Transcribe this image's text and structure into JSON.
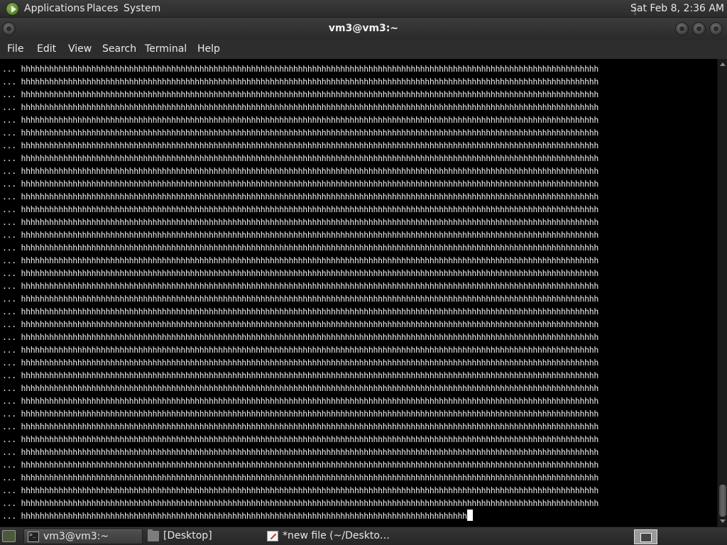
{
  "top_panel": {
    "menus": [
      "Applications",
      "Places",
      "System"
    ],
    "clock": "Sat Feb  8,  2:36 AM"
  },
  "window": {
    "title": "vm3@vm3:~"
  },
  "menubar": {
    "items": [
      "File",
      "Edit",
      "View",
      "Search",
      "Terminal",
      "Help"
    ]
  },
  "terminal": {
    "prompt": "...",
    "full_line": "hhhhhhhhhhhhhhhhhhhhhhhhhhhhhhhhhhhhhhhhhhhhhhhhhhhhhhhhhhhhhhhhhhhhhhhhhhhhhhhhhhhhhhhhhhhhhhhhhhhhhhhhhhhhhhhhhhhhhhhhhhh",
    "full_line_count": 35,
    "last_line": "hhhhhhhhhhhhhhhhhhhhhhhhhhhhhhhhhhhhhhhhhhhhhhhhhhhhhhhhhhhhhhhhhhhhhhhhhhhhhhhhhhhhhhhhhhhhhhh"
  },
  "taskbar": {
    "tasks": [
      {
        "label": "vm3@vm3:~",
        "icon": "terminal-icon",
        "active": true
      },
      {
        "label": "[Desktop]",
        "icon": "folder-icon",
        "active": false
      },
      {
        "label": "*new file (~/Deskto…",
        "icon": "text-editor-icon",
        "active": false
      }
    ]
  }
}
